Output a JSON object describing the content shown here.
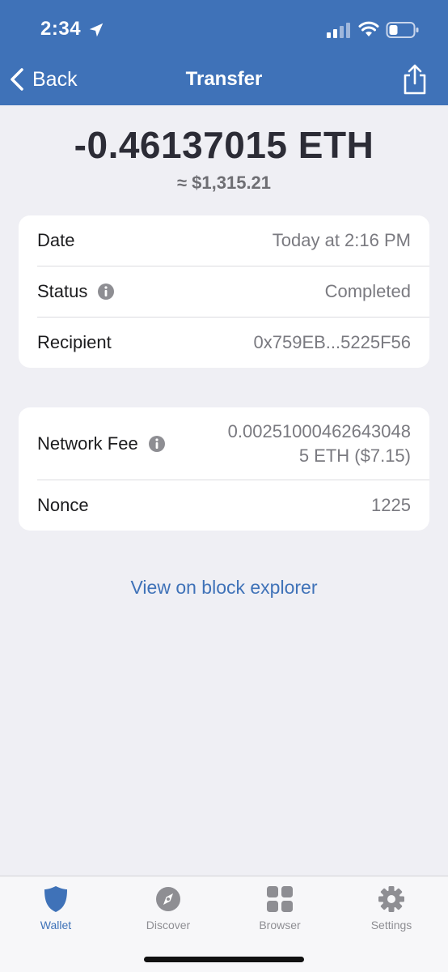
{
  "status_bar": {
    "time": "2:34"
  },
  "nav": {
    "back_label": "Back",
    "title": "Transfer"
  },
  "transaction": {
    "amount": "-0.46137015 ETH",
    "fiat": "≈ $1,315.21"
  },
  "details": [
    {
      "label": "Date",
      "value": "Today at 2:16 PM",
      "info": false
    },
    {
      "label": "Status",
      "value": "Completed",
      "info": true
    },
    {
      "label": "Recipient",
      "value": "0x759EB...5225F56",
      "info": false
    }
  ],
  "fees": {
    "network_fee_label": "Network Fee",
    "network_fee_line1": "0.00251000462643048",
    "network_fee_line2": "5 ETH ($7.15)",
    "nonce_label": "Nonce",
    "nonce_value": "1225"
  },
  "explorer_link": "View on block explorer",
  "tabs": [
    {
      "label": "Wallet",
      "icon": "shield-icon",
      "active": true
    },
    {
      "label": "Discover",
      "icon": "compass-icon",
      "active": false
    },
    {
      "label": "Browser",
      "icon": "grid-icon",
      "active": false
    },
    {
      "label": "Settings",
      "icon": "gear-icon",
      "active": false
    }
  ],
  "colors": {
    "header": "#3f72b8",
    "background": "#efeff4",
    "accent": "#3f72b8",
    "muted": "#8e8e93"
  }
}
